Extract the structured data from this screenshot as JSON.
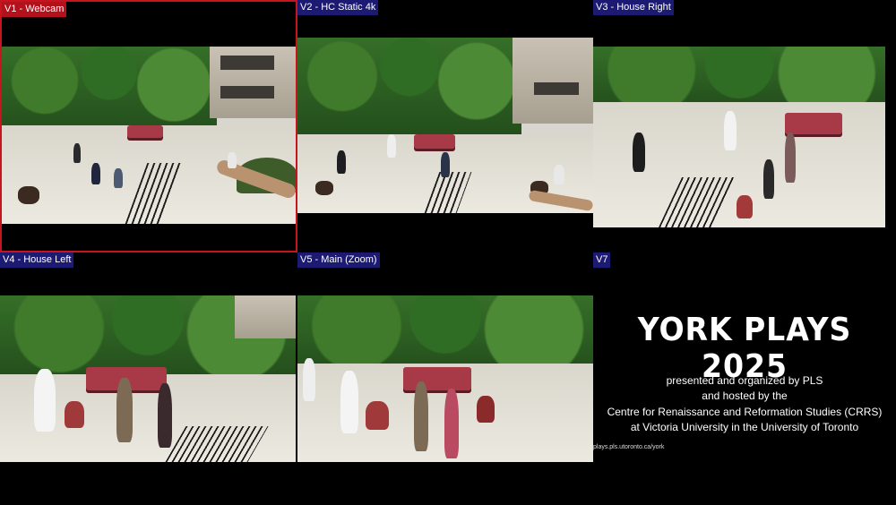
{
  "tiles": [
    {
      "label": "V1 - Webcam",
      "selected": true
    },
    {
      "label": "V2 - HC Static 4k",
      "selected": false
    },
    {
      "label": "V3 - House Right",
      "selected": false
    },
    {
      "label": "V4 - House Left",
      "selected": false
    },
    {
      "label": "V5 - Main (Zoom)",
      "selected": false
    },
    {
      "label": "V7",
      "selected": false
    }
  ],
  "title_card": {
    "title": "YORK PLAYS 2025",
    "line1": "presented and organized by PLS",
    "line2": "and hosted by the",
    "line3": "Centre for Renaissance and Reformation Studies (CRRS)",
    "line4": "at Victoria University in the University of Toronto",
    "url": "plays.pls.utoronto.ca/york"
  },
  "colors": {
    "selected_border": "#c8141e",
    "label_bg": "#1c1a72",
    "selected_label_bg": "#b3121d"
  }
}
